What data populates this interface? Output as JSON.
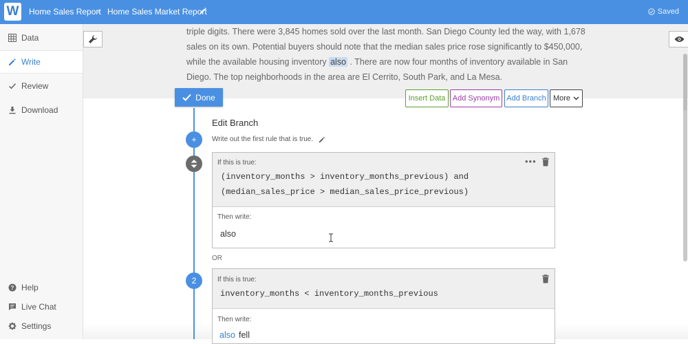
{
  "header": {
    "logo": "W",
    "breadcrumb_root": "Home Sales Report",
    "breadcrumb_separator": "›",
    "breadcrumb_current": "Home Sales Market Report",
    "status": "Saved"
  },
  "sidebar": {
    "items": [
      {
        "label": "Data",
        "icon": "grid-icon"
      },
      {
        "label": "Write",
        "icon": "pencil-icon"
      },
      {
        "label": "Review",
        "icon": "check-icon"
      },
      {
        "label": "Download",
        "icon": "download-icon"
      }
    ],
    "footer_items": [
      {
        "label": "Help",
        "icon": "help-icon"
      },
      {
        "label": "Live Chat",
        "icon": "chat-icon"
      },
      {
        "label": "Settings",
        "icon": "gear-icon"
      }
    ]
  },
  "preview": {
    "text_before": "triple digits. There were 3,845 homes sold over the last month. San Diego County led the way, with 1,678 sales on its own. Potential buyers should note that the median sales price rose significantly to $450,000, while the available housing inventory",
    "highlight": "also",
    "text_after": ". There are now four months of inventory available in San Diego. The top neighborhoods in the area are El Cerrito, South Park, and La Mesa."
  },
  "toolbar": {
    "done": "Done",
    "insert_data": "Insert Data",
    "add_synonym": "Add Synonym",
    "add_branch": "Add Branch",
    "more": "More"
  },
  "colors": {
    "accent": "#4a90e2",
    "insert_data": "#5aa02c",
    "add_synonym": "#9b3aa8",
    "add_branch": "#3a7fd0"
  },
  "branch": {
    "title": "Edit Branch",
    "hint": "Write out the first rule that is true.",
    "add_symbol": "+",
    "or_label": "OR",
    "rules": [
      {
        "number": "",
        "if_label": "If this is true:",
        "condition_line1": "(inventory_months > inventory_months_previous) and",
        "condition_line2": "(median_sales_price > median_sales_price_previous)",
        "then_label": "Then write:",
        "output": "also"
      },
      {
        "number": "2",
        "if_label": "If this is true:",
        "condition_line1": "inventory_months < inventory_months_previous",
        "then_label": "Then write:",
        "output_link": "also",
        "output_text": "fell"
      }
    ]
  }
}
